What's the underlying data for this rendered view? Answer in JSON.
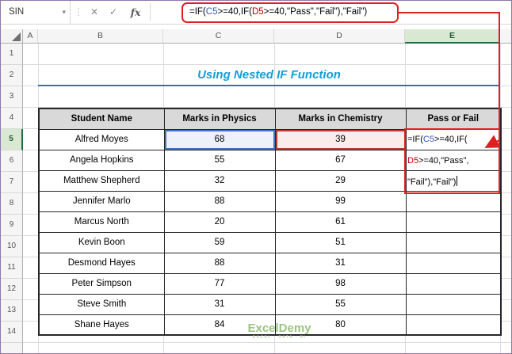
{
  "formula_bar": {
    "name_box_value": "SIN",
    "dropdown_icon": "▾",
    "grip_icon": "⋮",
    "cancel_label": "✕",
    "enter_label": "✓",
    "fx_label": "fx",
    "formula": "=IF(C5>=40,IF(D5>=40,\"Pass\",\"Fail\"),\"Fail\")",
    "parts": {
      "p1": "=IF(",
      "ref1": "C5",
      "p2": ">=40,IF(",
      "ref2": "D5",
      "p3": ">=40,\"Pass\",\"Fail\"),\"Fail\")"
    }
  },
  "grid": {
    "columns": [
      "A",
      "B",
      "C",
      "D",
      "E"
    ],
    "rows": [
      "1",
      "2",
      "3",
      "4",
      "5",
      "6",
      "7",
      "8",
      "9",
      "10",
      "11",
      "12",
      "13",
      "14"
    ],
    "active_column": "E",
    "active_row": "5"
  },
  "sheet_title": "Using Nested IF Function",
  "table": {
    "headers": [
      "Student Name",
      "Marks in Physics",
      "Marks in Chemistry",
      "Pass or Fail"
    ],
    "rows": [
      {
        "name": "Alfred Moyes",
        "physics": "68",
        "chemistry": "39"
      },
      {
        "name": "Angela Hopkins",
        "physics": "55",
        "chemistry": "67"
      },
      {
        "name": "Matthew Shepherd",
        "physics": "32",
        "chemistry": "29"
      },
      {
        "name": "Jennifer Marlo",
        "physics": "88",
        "chemistry": "99"
      },
      {
        "name": "Marcus North",
        "physics": "20",
        "chemistry": "61"
      },
      {
        "name": "Kevin Boon",
        "physics": "59",
        "chemistry": "51"
      },
      {
        "name": "Desmond Hayes",
        "physics": "88",
        "chemistry": "31"
      },
      {
        "name": "Peter Simpson",
        "physics": "77",
        "chemistry": "98"
      },
      {
        "name": "Steve Smith",
        "physics": "31",
        "chemistry": "55"
      },
      {
        "name": "Shane Hayes",
        "physics": "84",
        "chemistry": "80"
      }
    ]
  },
  "cell_formula": {
    "line1_a": "=IF(",
    "line1_ref": "C5",
    "line1_b": ">=40,IF(",
    "line2_ref": "D5",
    "line2_b": ">=40,\"Pass\",",
    "line3": "\"Fail\"),\"Fail\")"
  },
  "watermark": {
    "brand": "ExcelDemy",
    "tagline": "EXCEL · DATA · BI"
  },
  "colors": {
    "title_blue": "#109fd6",
    "title_underline": "#2e75b6",
    "reference_blue": "#3355c9",
    "reference_red": "#c00000",
    "annotation_red": "#e02020",
    "table_header_fill": "#d9d9d9",
    "active_header_fill": "#d9e8d2",
    "active_header_accent": "#1e7145",
    "watermark_green": "#8ebf72"
  }
}
